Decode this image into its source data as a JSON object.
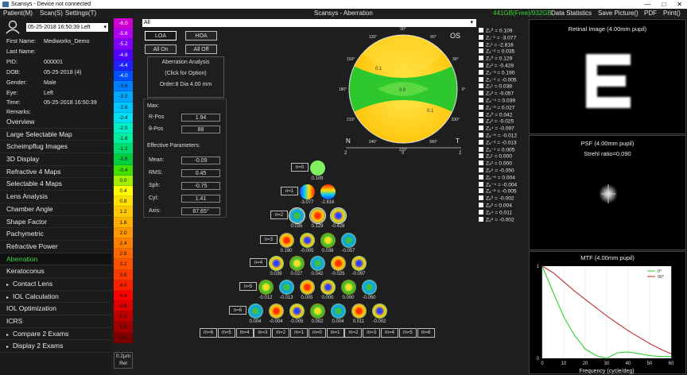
{
  "window": {
    "title": "Scansys - Device not connected",
    "controls": [
      "—",
      "□",
      "✕"
    ]
  },
  "menu": {
    "items": [
      "Patient(M)",
      "Scan(S)",
      "Settings(T)"
    ],
    "center_title": "Scansys - Aberration",
    "disk": "441GB(Free)/932GB",
    "right_items": [
      "Data Statistics",
      "Save Picture()",
      "PDF",
      "Print()"
    ]
  },
  "exam_selector": {
    "value": "05-25-2018 16:50:39 Left"
  },
  "patient": {
    "first_name_label": "First Name:",
    "first_name": "Mediworks_Demo",
    "last_name_label": "Last Name:",
    "last_name": "",
    "pid_label": "PID:",
    "pid": "000001",
    "dob_label": "DOB:",
    "dob": "05-25-2018  (4)",
    "gender_label": "Gender:",
    "gender": "Male",
    "eye_label": "Eye:",
    "eye": "Left",
    "time_label": "Time:",
    "time": "05-25-2018 16:50:39",
    "remarks_label": "Remarks:",
    "remarks": ""
  },
  "nav": [
    {
      "label": "Overview",
      "sub": false
    },
    {
      "label": "Large Selectable Map",
      "sub": false
    },
    {
      "label": "Scheimpflug Images",
      "sub": false
    },
    {
      "label": "3D Display",
      "sub": false
    },
    {
      "label": "Refractive 4 Maps",
      "sub": false
    },
    {
      "label": "Selectable 4 Maps",
      "sub": false
    },
    {
      "label": "Lens Analysis",
      "sub": false
    },
    {
      "label": "Chamber Angle",
      "sub": false
    },
    {
      "label": "Shape Factor",
      "sub": false
    },
    {
      "label": "Pachymetric",
      "sub": false
    },
    {
      "label": "Refractive Power",
      "sub": false
    },
    {
      "label": "Aberration",
      "sub": false,
      "active": true
    },
    {
      "label": "Keratoconus",
      "sub": false
    },
    {
      "label": "Contact Lens",
      "sub": true
    },
    {
      "label": "IOL Calculation",
      "sub": true
    },
    {
      "label": "IOL Optimization",
      "sub": false
    },
    {
      "label": "ICRS",
      "sub": false
    },
    {
      "label": "Compare 2 Exams",
      "sub": true
    },
    {
      "label": "Display 2 Exams",
      "sub": true
    }
  ],
  "color_scale": {
    "values": [
      "-6.0",
      "-5.6",
      "-5.2",
      "-4.8",
      "-4.4",
      "-4.0",
      "-3.6",
      "-3.2",
      "-2.8",
      "-2.4",
      "-2.0",
      "-1.6",
      "-1.2",
      "-0.8",
      "-0.4",
      "0.0",
      "0.4",
      "0.8",
      "1.2",
      "1.6",
      "2.0",
      "2.4",
      "2.8",
      "3.2",
      "3.6",
      "4.0",
      "4.4",
      "4.8",
      "5.2",
      "5.6",
      "6.0"
    ],
    "colors": [
      "#d000d0",
      "#b000f0",
      "#8000ff",
      "#5000ff",
      "#2020ff",
      "#0050ff",
      "#0080ff",
      "#00a8ff",
      "#00c8ff",
      "#00e0f0",
      "#00f0c8",
      "#00f0a0",
      "#00e070",
      "#00d040",
      "#40e000",
      "#a0f000",
      "#ffff00",
      "#ffe000",
      "#ffc800",
      "#ffb000",
      "#ff9800",
      "#ff8000",
      "#ff6800",
      "#ff5000",
      "#ff3800",
      "#ff2000",
      "#ff0000",
      "#e00000",
      "#c00000",
      "#a00000",
      "#800000"
    ],
    "unit": "0.2µm",
    "mode": "Rel"
  },
  "filter": {
    "value": "All"
  },
  "controls": {
    "loa": "LOA",
    "hoa": "HOA",
    "all_on": "All On",
    "all_off": "All Off"
  },
  "analysis": {
    "title": "Aberration Analysis",
    "hint": "(Click for Option)",
    "order_text": "Order:8  Dia 4.00 mm"
  },
  "max": {
    "title": "Max:",
    "r_label": "R-Pos",
    "r_value": "1.94",
    "theta_label": "θ-Pos",
    "theta_value": "88"
  },
  "effective": {
    "title": "Effective Parameters:",
    "mean_label": "Mean:",
    "mean": "-0.09",
    "rms_label": "RMS:",
    "rms": "0.45",
    "sph_label": "Sph:",
    "sph": "-0.75",
    "cyl_label": "Cyl:",
    "cyl": "1.41",
    "axis_label": "Axis:",
    "axis": "87.65°"
  },
  "map": {
    "eye": "OS",
    "nasal": "N",
    "temporal": "T",
    "axis_ticks": [
      "2",
      "0",
      "2"
    ],
    "contour_labels": [
      "0.1",
      "0.0",
      "0.1"
    ],
    "angles": [
      "0°",
      "30°",
      "60°",
      "90°",
      "120°",
      "150°",
      "180°",
      "210°",
      "240°",
      "270°",
      "300°",
      "330°"
    ]
  },
  "coefficients": [
    "Z₁⁻¹ = -3.077",
    "Z₁¹ = -2.816",
    "Z₂⁻² = 0.035",
    "Z₂⁰ = 0.129",
    "Z₂² = -0.428",
    "Z₃⁻³ = 0.190",
    "Z₃⁻¹ = -0.005",
    "Z₃¹ = 0.038",
    "Z₃³ = -0.057",
    "Z₄⁻⁴ = 0.039",
    "Z₄⁻² = 0.027",
    "Z₄⁰ = 0.042",
    "Z₄² = -0.025",
    "Z₄⁴ = -0.097",
    "Z₅⁻⁵ = -0.012",
    "Z₅⁻³ = -0.013",
    "Z₅⁻¹ = 0.005",
    "Z₅¹ = 0.000",
    "Z₅³ = 0.000",
    "Z₅⁵ = -0.050",
    "Z₆⁻⁶ = 0.004",
    "Z₆⁻⁴ = -0.004",
    "Z₆⁻² = -0.005",
    "Z₆⁰ = -0.002",
    "Z₆² = 0.004",
    "Z₆⁴ = 0.011",
    "Z₆⁶ = -0.002"
  ],
  "coef_first": "Z₀⁰ = 0.109",
  "pyramid": {
    "rows": [
      {
        "label": "n=0",
        "values": [
          "0.109"
        ]
      },
      {
        "label": "n=1",
        "values": [
          "-3.077",
          "-2.816"
        ]
      },
      {
        "label": "n=2",
        "values": [
          "0.035",
          "0.129",
          "-0.428"
        ]
      },
      {
        "label": "n=3",
        "values": [
          "0.190",
          "-0.005",
          "0.038",
          "-0.057"
        ]
      },
      {
        "label": "n=4",
        "values": [
          "0.039",
          "0.027",
          "0.042",
          "-0.025",
          "-0.097"
        ]
      },
      {
        "label": "n=5",
        "values": [
          "-0.012",
          "-0.013",
          "0.005",
          "0.000",
          "0.000",
          "-0.050"
        ]
      },
      {
        "label": "n=6",
        "values": [
          "0.004",
          "-0.004",
          "-0.005",
          "0.002",
          "0.004",
          "0.011",
          "-0.002"
        ]
      }
    ],
    "order_buttons": [
      "m=6",
      "m=5",
      "m=4",
      "m=3",
      "m=2",
      "m=1",
      "m=0",
      "m=1",
      "m=2",
      "m=3",
      "m=4",
      "m=5",
      "m=6"
    ]
  },
  "retinal": {
    "title": "Retinal Image (4.00mm pupil)",
    "letter": "E"
  },
  "psf": {
    "title": "PSF (4.00mm pupil)",
    "strehl": "Strehl ratio=0.090"
  },
  "mtf": {
    "title": "MTF (4.00mm pupil)",
    "xlabel": "Frequency (cycle/deg)",
    "x_ticks": [
      "0",
      "10",
      "20",
      "30",
      "40",
      "50",
      "60"
    ],
    "y_ticks": [
      "0",
      "1"
    ],
    "legend": [
      "0°",
      "90°"
    ],
    "colors": [
      "#30d030",
      "#c03030"
    ]
  },
  "chart_data": {
    "type": "line",
    "title": "MTF (4.00mm pupil)",
    "xlabel": "Frequency (cycle/deg)",
    "ylabel": "",
    "xlim": [
      0,
      60
    ],
    "ylim": [
      0,
      1
    ],
    "x": [
      0,
      5,
      10,
      15,
      20,
      25,
      30,
      35,
      40,
      45,
      50,
      55,
      60
    ],
    "series": [
      {
        "name": "0°",
        "values": [
          1.0,
          0.72,
          0.45,
          0.25,
          0.1,
          0.03,
          0.0,
          0.06,
          0.07,
          0.05,
          0.03,
          0.02,
          0.02
        ]
      },
      {
        "name": "90°",
        "values": [
          1.0,
          0.93,
          0.83,
          0.73,
          0.64,
          0.55,
          0.46,
          0.38,
          0.3,
          0.23,
          0.16,
          0.1,
          0.05
        ]
      }
    ]
  }
}
